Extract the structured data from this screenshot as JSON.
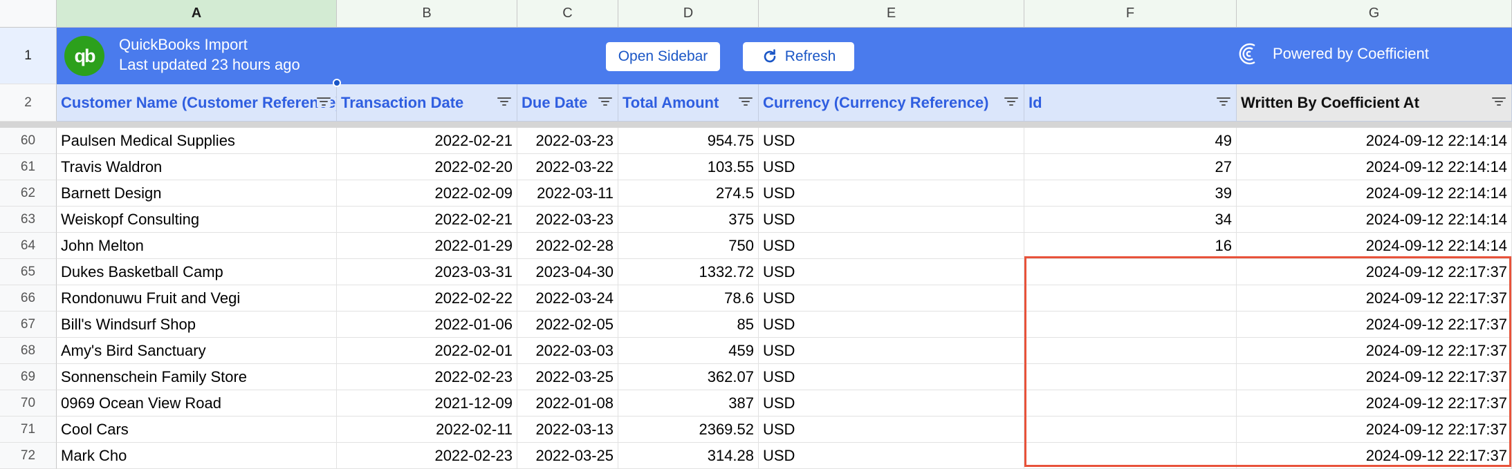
{
  "column_letters": [
    "A",
    "B",
    "C",
    "D",
    "E",
    "F",
    "G"
  ],
  "banner": {
    "title": "QuickBooks Import",
    "subtitle": "Last updated 23 hours ago",
    "open_sidebar_label": "Open Sidebar",
    "refresh_label": "Refresh",
    "powered_by": "Powered by Coefficient",
    "row_number": "1"
  },
  "headers": {
    "row_number": "2",
    "labels": [
      "Customer Name (Customer Reference)",
      "Transaction Date",
      "Due Date",
      "Total Amount",
      "Currency (Currency Reference)",
      "Id",
      "Written By Coefficient At"
    ]
  },
  "rows": [
    {
      "num": "60",
      "customer": "Paulsen Medical Supplies",
      "txn_date": "2022-02-21",
      "due_date": "2022-03-23",
      "amount": "954.75",
      "currency": "USD",
      "id": "49",
      "written_at": "2024-09-12 22:14:14"
    },
    {
      "num": "61",
      "customer": "Travis Waldron",
      "txn_date": "2022-02-20",
      "due_date": "2022-03-22",
      "amount": "103.55",
      "currency": "USD",
      "id": "27",
      "written_at": "2024-09-12 22:14:14"
    },
    {
      "num": "62",
      "customer": "Barnett Design",
      "txn_date": "2022-02-09",
      "due_date": "2022-03-11",
      "amount": "274.5",
      "currency": "USD",
      "id": "39",
      "written_at": "2024-09-12 22:14:14"
    },
    {
      "num": "63",
      "customer": "Weiskopf Consulting",
      "txn_date": "2022-02-21",
      "due_date": "2022-03-23",
      "amount": "375",
      "currency": "USD",
      "id": "34",
      "written_at": "2024-09-12 22:14:14"
    },
    {
      "num": "64",
      "customer": "John Melton",
      "txn_date": "2022-01-29",
      "due_date": "2022-02-28",
      "amount": "750",
      "currency": "USD",
      "id": "16",
      "written_at": "2024-09-12 22:14:14"
    },
    {
      "num": "65",
      "customer": "Dukes Basketball Camp",
      "txn_date": "2023-03-31",
      "due_date": "2023-04-30",
      "amount": "1332.72",
      "currency": "USD",
      "id": "",
      "written_at": "2024-09-12 22:17:37"
    },
    {
      "num": "66",
      "customer": "Rondonuwu Fruit and Vegi",
      "txn_date": "2022-02-22",
      "due_date": "2022-03-24",
      "amount": "78.6",
      "currency": "USD",
      "id": "",
      "written_at": "2024-09-12 22:17:37"
    },
    {
      "num": "67",
      "customer": "Bill's Windsurf Shop",
      "txn_date": "2022-01-06",
      "due_date": "2022-02-05",
      "amount": "85",
      "currency": "USD",
      "id": "",
      "written_at": "2024-09-12 22:17:37"
    },
    {
      "num": "68",
      "customer": "Amy's Bird Sanctuary",
      "txn_date": "2022-02-01",
      "due_date": "2022-03-03",
      "amount": "459",
      "currency": "USD",
      "id": "",
      "written_at": "2024-09-12 22:17:37"
    },
    {
      "num": "69",
      "customer": "Sonnenschein Family Store",
      "txn_date": "2022-02-23",
      "due_date": "2022-03-25",
      "amount": "362.07",
      "currency": "USD",
      "id": "",
      "written_at": "2024-09-12 22:17:37"
    },
    {
      "num": "70",
      "customer": "0969 Ocean View Road",
      "txn_date": "2021-12-09",
      "due_date": "2022-01-08",
      "amount": "387",
      "currency": "USD",
      "id": "",
      "written_at": "2024-09-12 22:17:37"
    },
    {
      "num": "71",
      "customer": "Cool Cars",
      "txn_date": "2022-02-11",
      "due_date": "2022-03-13",
      "amount": "2369.52",
      "currency": "USD",
      "id": "",
      "written_at": "2024-09-12 22:17:37"
    },
    {
      "num": "72",
      "customer": "Mark Cho",
      "txn_date": "2022-02-23",
      "due_date": "2022-03-25",
      "amount": "314.28",
      "currency": "USD",
      "id": "",
      "written_at": "2024-09-12 22:17:37"
    }
  ],
  "colors": {
    "banner": "#4a7bed",
    "header_bg": "#dbe6fb",
    "header_text": "#2f5ee0",
    "highlight_border": "#e8523a",
    "quickbooks_green": "#2ca01c"
  }
}
